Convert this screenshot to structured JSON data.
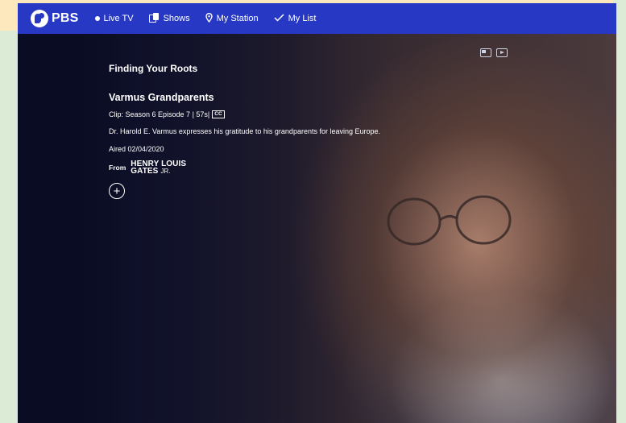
{
  "header": {
    "logo_text": "PBS",
    "nav": [
      {
        "label": "Live TV",
        "icon": "live-dot-icon"
      },
      {
        "label": "Shows",
        "icon": "shows-icon"
      },
      {
        "label": "My Station",
        "icon": "location-pin-icon"
      },
      {
        "label": "My List",
        "icon": "checkmark-icon"
      }
    ]
  },
  "player": {
    "controls": [
      "picture-in-picture-icon",
      "play-preview-icon"
    ]
  },
  "info": {
    "show_title": "Finding Your Roots",
    "episode_title": "Varmus Grandparents",
    "meta": "Clip: Season 6 Episode 7 | 57s|",
    "cc_badge": "CC",
    "description": "Dr. Harold E. Varmus expresses his gratitude to his grandparents for leaving Europe.",
    "aired": "Aired 02/04/2020",
    "from_label": "From",
    "brand_line1": "HENRY LOUIS",
    "brand_line2": "GATES",
    "brand_jr": "JR.",
    "add_symbol": "+"
  },
  "colors": {
    "topbar": "#2638c4",
    "background": "#0b0d24",
    "page_outer": "#dcebd6",
    "tan_edge": "#fde8bd"
  }
}
